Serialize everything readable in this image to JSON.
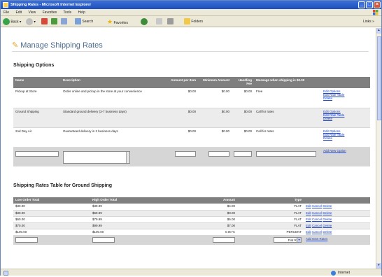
{
  "window": {
    "title": "Shipping Rates - Microsoft Internet Explorer"
  },
  "menu": [
    "File",
    "Edit",
    "View",
    "Favorites",
    "Tools",
    "Help"
  ],
  "toolbar": {
    "back": "Back",
    "search": "Search",
    "favorites": "Favorites",
    "folders": "Folders",
    "links": "Links"
  },
  "page": {
    "title": "Manage Shipping Rates"
  },
  "options": {
    "heading": "Shipping Options",
    "headers": [
      "Name",
      "Description",
      "Amount per Item",
      "Minimum Amount",
      "Handling Fee",
      "Message when shipping is $0.00",
      ""
    ],
    "rows": [
      {
        "name": "Pickup at Store",
        "description": "Order online and pickup in the store at your convenience",
        "amount": "$0.00",
        "minimum": "$0.00",
        "handling": "$0.00",
        "message": "Free"
      },
      {
        "name": "Ground Shipping",
        "description": "Standard ground delivery (3-7 business days)",
        "amount": "$0.00",
        "minimum": "$0.00",
        "handling": "$0.00",
        "message": "Call for rates"
      },
      {
        "name": "2nd Day Air",
        "description": "Guaranteed delivery in 2 business days",
        "amount": "$0.00",
        "minimum": "$0.00",
        "handling": "$0.00",
        "message": "Call for rates"
      }
    ],
    "actions": {
      "edit_options": "Edit Options",
      "edit_rate_table": "Edit Rate Table",
      "delete": "Delete"
    },
    "add_new": "Add New Option"
  },
  "rates": {
    "heading": "Shipping Rates Table for Ground Shipping",
    "headers": [
      "Low Order Total",
      "High Order Total",
      "Amount",
      "Type"
    ],
    "rows": [
      {
        "low": "$30.00",
        "high": "$39.99",
        "amount": "$4.00",
        "type": "FLAT"
      },
      {
        "low": "$30.00",
        "high": "$69.99",
        "amount": "$0.00",
        "type": "FLAT"
      },
      {
        "low": "$60.00",
        "high": "$79.99",
        "amount": "$6.00",
        "type": "FLAT"
      },
      {
        "low": "$70.00",
        "high": "$99.99",
        "amount": "$7.00",
        "type": "FLAT"
      },
      {
        "low": "$100.00",
        "high": "$100.00",
        "amount": "0.00 %",
        "type": "PERCENT"
      }
    ],
    "actions": {
      "edit": "Edit",
      "cancel": "Cancel",
      "delete": "Delete"
    },
    "type_selected": "Flat Rate",
    "add_new": "Add New Rates"
  },
  "status": {
    "zone": "Internet"
  }
}
